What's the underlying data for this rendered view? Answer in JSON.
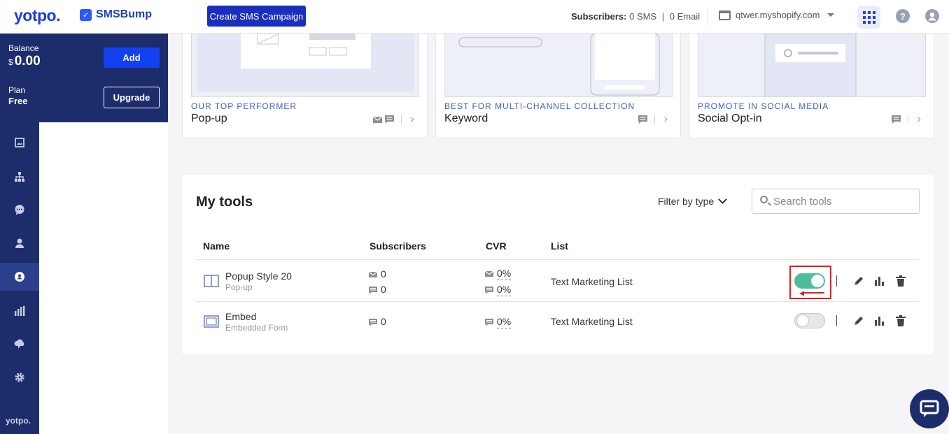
{
  "header": {
    "brand": "yotpo.",
    "product": "SMSBump",
    "create_button": "Create SMS Campaign",
    "subscribers_label": "Subscribers:",
    "subscribers_sms": "0 SMS",
    "subscribers_sep": "|",
    "subscribers_email": "0 Email",
    "shop": "qtwer.myshopify.com",
    "help_icon_glyph": "?"
  },
  "account": {
    "balance_label": "Balance",
    "currency": "$",
    "balance_value": "0.00",
    "add_button": "Add",
    "plan_label": "Plan",
    "plan_value": "Free",
    "upgrade_button": "Upgrade"
  },
  "sidebar": {
    "icons": [
      "image-icon",
      "sitemap-icon",
      "chat-bubble-icon",
      "person-icon",
      "subscriber-tools-icon",
      "bar-chart-icon",
      "cloud-chat-icon",
      "gear-icon"
    ],
    "active_index": 4,
    "footer_brand": "yotpo."
  },
  "cards": [
    {
      "category": "OUR TOP PERFORMER",
      "title": "Pop-up",
      "icons": [
        "email-icon",
        "sms-icon"
      ]
    },
    {
      "category": "BEST FOR MULTI-CHANNEL COLLECTION",
      "title": "Keyword",
      "icons": [
        "sms-icon"
      ]
    },
    {
      "category": "PROMOTE IN SOCIAL MEDIA",
      "title": "Social Opt-in",
      "icons": [
        "sms-icon"
      ]
    }
  ],
  "tools": {
    "title": "My tools",
    "filter_label": "Filter by type",
    "search_placeholder": "Search tools",
    "columns": {
      "name": "Name",
      "subscribers": "Subscribers",
      "cvr": "CVR",
      "list": "List"
    },
    "rows": [
      {
        "name": "Popup Style 20",
        "type": "Pop-up",
        "email_subs": "0",
        "sms_subs": "0",
        "email_cvr": "0%",
        "sms_cvr": "0%",
        "list": "Text Marketing List",
        "enabled": true
      },
      {
        "name": "Embed",
        "type": "Embedded Form",
        "sms_subs": "0",
        "sms_cvr": "0%",
        "list": "Text Marketing List",
        "enabled": false
      }
    ]
  },
  "colors": {
    "brand_blue": "#1a3de0",
    "sidebar_navy": "#1d2d6b",
    "toggle_on": "#4bbf9c",
    "highlight_red": "#e02020"
  }
}
